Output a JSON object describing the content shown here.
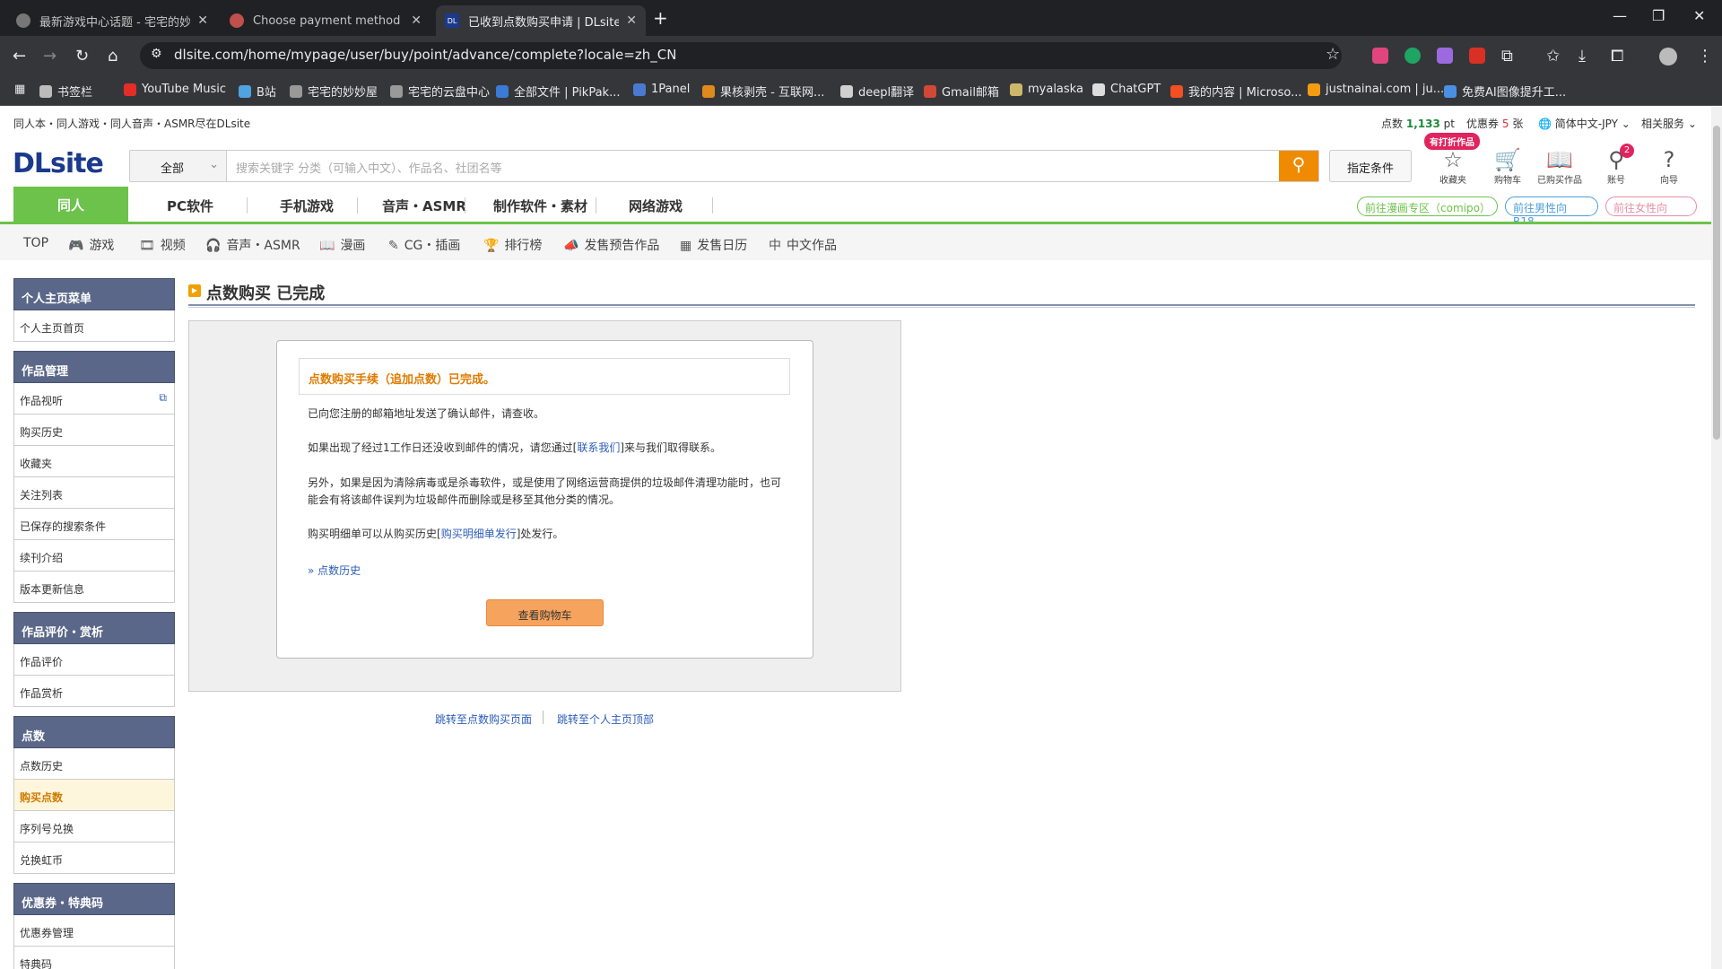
{
  "browser": {
    "tabs": [
      {
        "title": "最新游戏中心话题 - 宅宅的妙妙"
      },
      {
        "title": "Choose payment method - C"
      },
      {
        "title": "已收到点数购买申请 | DLsite 同"
      }
    ],
    "url": "dlsite.com/home/mypage/user/buy/point/advance/complete?locale=zh_CN",
    "bookmarks": [
      {
        "label": "书签栏",
        "color": "#bbbbbb"
      },
      {
        "label": "YouTube Music",
        "color": "#e52d27"
      },
      {
        "label": "B站",
        "color": "#4fa3e0"
      },
      {
        "label": "宅宅的妙妙屋",
        "color": "#999999"
      },
      {
        "label": "宅宅的云盘中心",
        "color": "#999999"
      },
      {
        "label": "全部文件 | PikPak...",
        "color": "#3a7bd5"
      },
      {
        "label": "1Panel",
        "color": "#4a7ad0"
      },
      {
        "label": "果核剥壳 - 互联网...",
        "color": "#e08a1c"
      },
      {
        "label": "deepl翻译",
        "color": "#d0d0d0"
      },
      {
        "label": "Gmail邮箱",
        "color": "#d14836"
      },
      {
        "label": "myalaska",
        "color": "#cdb86a"
      },
      {
        "label": "ChatGPT",
        "color": "#dddddd"
      },
      {
        "label": "我的内容 | Microso...",
        "color": "#f25022"
      },
      {
        "label": "justnainai.com | ju...",
        "color": "#f39c12"
      },
      {
        "label": "免费AI图像提升工...",
        "color": "#4a90e2"
      }
    ]
  },
  "site": {
    "tagline": "同人本・同人游戏・同人音声・ASMR尽在DLsite",
    "points_label": "点数",
    "points_value": "1,133",
    "points_unit": "pt",
    "coupon_label": "优惠券",
    "coupon_value": "5",
    "coupon_unit": "张",
    "locale": "简体中文-JPY",
    "related": "相关服务",
    "logo": "DLsite",
    "search_category": "全部",
    "search_placeholder": "搜索关键字  分类（可输入中文）、作品名、社团名等",
    "cond_button": "指定条件",
    "fav_badge": "有打折作品",
    "header_icons": [
      {
        "label": "收藏夹",
        "icon": "star-icon",
        "glyph": "☆"
      },
      {
        "label": "购物车",
        "icon": "cart-icon",
        "glyph": "🛒"
      },
      {
        "label": "已购买作品",
        "icon": "book-icon",
        "glyph": "📖"
      },
      {
        "label": "账号",
        "icon": "account-icon",
        "glyph": "⚲"
      },
      {
        "label": "向导",
        "icon": "help-icon",
        "glyph": "?"
      }
    ],
    "account_badge": "2",
    "nav_active": "同人",
    "nav": [
      "PC软件",
      "手机游戏",
      "音声・ASMR",
      "制作软件・素材",
      "网络游戏"
    ],
    "pills": [
      {
        "label": "前往漫画专区（comipo）",
        "color": "#6cc24a"
      },
      {
        "label": "前往男性向 R18",
        "color": "#4a9ed8"
      },
      {
        "label": "前往女性向",
        "color": "#e58fa6"
      }
    ],
    "subnav": [
      {
        "label": "TOP",
        "icon": ""
      },
      {
        "label": "游戏",
        "icon": "🎮"
      },
      {
        "label": "视频",
        "icon": "🎞"
      },
      {
        "label": "音声・ASMR",
        "icon": "🎧"
      },
      {
        "label": "漫画",
        "icon": "📖"
      },
      {
        "label": "CG・插画",
        "icon": "✎"
      },
      {
        "label": "排行榜",
        "icon": "🏆"
      },
      {
        "label": "发售预告作品",
        "icon": "📣"
      },
      {
        "label": "发售日历",
        "icon": "▦"
      },
      {
        "label": "中文作品",
        "icon": "中"
      }
    ]
  },
  "sidebar": [
    {
      "head": "个人主页菜单",
      "items": [
        "个人主页首页"
      ]
    },
    {
      "head": "作品管理",
      "items": [
        "作品视听",
        "购买历史",
        "收藏夹",
        "关注列表",
        "已保存的搜索条件",
        "续刊介绍",
        "版本更新信息"
      ]
    },
    {
      "head": "作品评价・赏析",
      "items": [
        "作品评价",
        "作品赏析"
      ]
    },
    {
      "head": "点数",
      "items": [
        "点数历史",
        "购买点数",
        "序列号兑换",
        "兑换虹币"
      ]
    },
    {
      "head": "优惠券・特典码",
      "items": [
        "优惠券管理",
        "特典码"
      ]
    }
  ],
  "main": {
    "title": "点数购买 已完成",
    "notice": "点数购买手续（追加点数）已完成。",
    "p1": "已向您注册的邮箱地址发送了确认邮件，请查收。",
    "p2_pre": "如果出现了经过1工作日还没收到邮件的情况，请您通过[",
    "p2_link": "联系我们",
    "p2_post": "]来与我们取得联系。",
    "p3": "另外，如果是因为清除病毒或是杀毒软件，或是使用了网络运营商提供的垃圾邮件清理功能时，也可能会有将该邮件误判为垃圾邮件而删除或是移至其他分类的情况。",
    "p4_pre": "购买明细单可以从购买历史[",
    "p4_link": "购买明细单发行",
    "p4_post": "]处发行。",
    "history_link": "点数历史",
    "cart_button": "查看购物车",
    "foot_link1": "跳转至点数购买页面",
    "foot_link2": "跳转至个人主页顶部"
  }
}
